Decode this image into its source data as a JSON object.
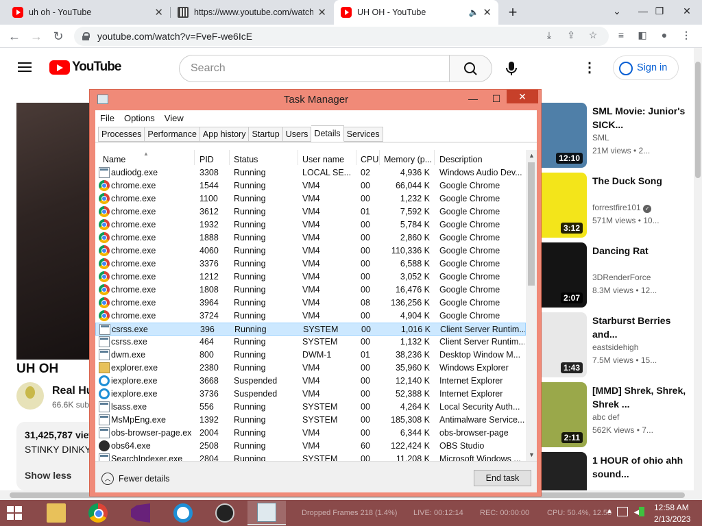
{
  "browser": {
    "tabs": [
      {
        "title": "uh oh - YouTube"
      },
      {
        "title": "https://www.youtube.com/watch"
      },
      {
        "title": "UH OH - YouTube"
      }
    ],
    "new_tab": "+",
    "url": "youtube.com/watch?v=FveF-we6IcE"
  },
  "youtube": {
    "logo_text": "YouTube",
    "search_placeholder": "Search",
    "sign_in": "Sign in",
    "video_title": "UH OH",
    "channel_name": "Real Hu",
    "channel_subs": "66.6K sub",
    "views": "31,425,787 view",
    "description": "STINKY DINKY",
    "show_less": "Show less",
    "recommendations": [
      {
        "title": "SML Movie: Junior's SICK...",
        "channel": "SML",
        "views": "21M views • 2...",
        "duration": "12:10",
        "verified": false,
        "thumb_color": "#4f7fa8"
      },
      {
        "title": "The Duck Song",
        "channel": "forrestfire101",
        "views": "571M views • 10...",
        "duration": "3:12",
        "verified": true,
        "thumb_color": "#f3e51a"
      },
      {
        "title": "Dancing Rat",
        "channel": "3DRenderForce",
        "views": "8.3M views • 12...",
        "duration": "2:07",
        "verified": false,
        "thumb_color": "#141414"
      },
      {
        "title": "Starburst Berries and...",
        "channel": "eastsidehigh",
        "views": "7.5M views • 15...",
        "duration": "1:43",
        "verified": false,
        "thumb_color": "#e8e8e8"
      },
      {
        "title": "[MMD] Shrek, Shrek, Shrek ...",
        "channel": "abc def",
        "views": "562K views • 7...",
        "duration": "2:11",
        "verified": false,
        "thumb_color": "#9aa84a"
      },
      {
        "title": "1 HOUR of ohio ahh sound...",
        "channel": "",
        "views": "",
        "duration": "",
        "verified": false,
        "thumb_color": "#222222"
      }
    ]
  },
  "taskmanager": {
    "title": "Task Manager",
    "menu": [
      "File",
      "Options",
      "View"
    ],
    "tabs": [
      "Processes",
      "Performance",
      "App history",
      "Startup",
      "Users",
      "Details",
      "Services"
    ],
    "active_tab": "Details",
    "columns": [
      "Name",
      "PID",
      "Status",
      "User name",
      "CPU",
      "Memory (p...",
      "Description"
    ],
    "rows": [
      {
        "icon": "app-icon",
        "name": "audiodg.exe",
        "pid": "3308",
        "status": "Running",
        "user": "LOCAL SE...",
        "cpu": "02",
        "mem": "4,936 K",
        "desc": "Windows Audio Dev..."
      },
      {
        "icon": "chrome-icon",
        "name": "chrome.exe",
        "pid": "1544",
        "status": "Running",
        "user": "VM4",
        "cpu": "00",
        "mem": "66,044 K",
        "desc": "Google Chrome"
      },
      {
        "icon": "chrome-icon",
        "name": "chrome.exe",
        "pid": "1100",
        "status": "Running",
        "user": "VM4",
        "cpu": "00",
        "mem": "1,232 K",
        "desc": "Google Chrome"
      },
      {
        "icon": "chrome-icon",
        "name": "chrome.exe",
        "pid": "3612",
        "status": "Running",
        "user": "VM4",
        "cpu": "01",
        "mem": "7,592 K",
        "desc": "Google Chrome"
      },
      {
        "icon": "chrome-icon",
        "name": "chrome.exe",
        "pid": "1932",
        "status": "Running",
        "user": "VM4",
        "cpu": "00",
        "mem": "5,784 K",
        "desc": "Google Chrome"
      },
      {
        "icon": "chrome-icon",
        "name": "chrome.exe",
        "pid": "1888",
        "status": "Running",
        "user": "VM4",
        "cpu": "00",
        "mem": "2,860 K",
        "desc": "Google Chrome"
      },
      {
        "icon": "chrome-icon",
        "name": "chrome.exe",
        "pid": "4060",
        "status": "Running",
        "user": "VM4",
        "cpu": "00",
        "mem": "110,336 K",
        "desc": "Google Chrome"
      },
      {
        "icon": "chrome-icon",
        "name": "chrome.exe",
        "pid": "3376",
        "status": "Running",
        "user": "VM4",
        "cpu": "00",
        "mem": "6,588 K",
        "desc": "Google Chrome"
      },
      {
        "icon": "chrome-icon",
        "name": "chrome.exe",
        "pid": "1212",
        "status": "Running",
        "user": "VM4",
        "cpu": "00",
        "mem": "3,052 K",
        "desc": "Google Chrome"
      },
      {
        "icon": "chrome-icon",
        "name": "chrome.exe",
        "pid": "1808",
        "status": "Running",
        "user": "VM4",
        "cpu": "00",
        "mem": "16,476 K",
        "desc": "Google Chrome"
      },
      {
        "icon": "chrome-icon",
        "name": "chrome.exe",
        "pid": "3964",
        "status": "Running",
        "user": "VM4",
        "cpu": "08",
        "mem": "136,256 K",
        "desc": "Google Chrome"
      },
      {
        "icon": "chrome-icon",
        "name": "chrome.exe",
        "pid": "3724",
        "status": "Running",
        "user": "VM4",
        "cpu": "00",
        "mem": "4,904 K",
        "desc": "Google Chrome"
      },
      {
        "icon": "app-icon",
        "name": "csrss.exe",
        "pid": "396",
        "status": "Running",
        "user": "SYSTEM",
        "cpu": "00",
        "mem": "1,016 K",
        "desc": "Client Server Runtim...",
        "selected": true
      },
      {
        "icon": "app-icon",
        "name": "csrss.exe",
        "pid": "464",
        "status": "Running",
        "user": "SYSTEM",
        "cpu": "00",
        "mem": "1,132 K",
        "desc": "Client Server Runtim..."
      },
      {
        "icon": "app-icon",
        "name": "dwm.exe",
        "pid": "800",
        "status": "Running",
        "user": "DWM-1",
        "cpu": "01",
        "mem": "38,236 K",
        "desc": "Desktop Window M..."
      },
      {
        "icon": "explorer-icon",
        "name": "explorer.exe",
        "pid": "2380",
        "status": "Running",
        "user": "VM4",
        "cpu": "00",
        "mem": "35,960 K",
        "desc": "Windows Explorer"
      },
      {
        "icon": "ie-icon",
        "name": "iexplore.exe",
        "pid": "3668",
        "status": "Suspended",
        "user": "VM4",
        "cpu": "00",
        "mem": "12,140 K",
        "desc": "Internet Explorer"
      },
      {
        "icon": "ie-icon",
        "name": "iexplore.exe",
        "pid": "3736",
        "status": "Suspended",
        "user": "VM4",
        "cpu": "00",
        "mem": "52,388 K",
        "desc": "Internet Explorer"
      },
      {
        "icon": "app-icon",
        "name": "lsass.exe",
        "pid": "556",
        "status": "Running",
        "user": "SYSTEM",
        "cpu": "00",
        "mem": "4,264 K",
        "desc": "Local Security Auth..."
      },
      {
        "icon": "app-icon",
        "name": "MsMpEng.exe",
        "pid": "1392",
        "status": "Running",
        "user": "SYSTEM",
        "cpu": "00",
        "mem": "185,308 K",
        "desc": "Antimalware Service..."
      },
      {
        "icon": "app-icon",
        "name": "obs-browser-page.exe",
        "pid": "2004",
        "status": "Running",
        "user": "VM4",
        "cpu": "00",
        "mem": "6,344 K",
        "desc": "obs-browser-page"
      },
      {
        "icon": "obs-icon",
        "name": "obs64.exe",
        "pid": "2508",
        "status": "Running",
        "user": "VM4",
        "cpu": "60",
        "mem": "122,424 K",
        "desc": "OBS Studio"
      },
      {
        "icon": "app-icon",
        "name": "SearchIndexer.exe",
        "pid": "2804",
        "status": "Running",
        "user": "SYSTEM",
        "cpu": "00",
        "mem": "11,208 K",
        "desc": "Microsoft Windows ..."
      }
    ],
    "fewer_details": "Fewer details",
    "end_task": "End task"
  },
  "taskbar": {
    "apps": [
      "file-explorer",
      "chrome",
      "visual-studio",
      "internet-explorer",
      "obs-studio",
      "task-manager"
    ],
    "active_app": "task-manager",
    "overlay": {
      "dropped_frames": "Dropped Frames 218 (1.4%)",
      "live": "LIVE: 00:12:14",
      "rec": "REC: 00:00:00",
      "cpu": "CPU: 50.4%, 12.58"
    },
    "time": "12:58 AM",
    "date": "2/13/2023"
  },
  "colors": {
    "taskmanager_frame": "#f08a78",
    "taskbar": "#8a4a4a",
    "youtube_red": "#ff0000",
    "signin_blue": "#065fd4",
    "selection": "#cce8ff"
  }
}
